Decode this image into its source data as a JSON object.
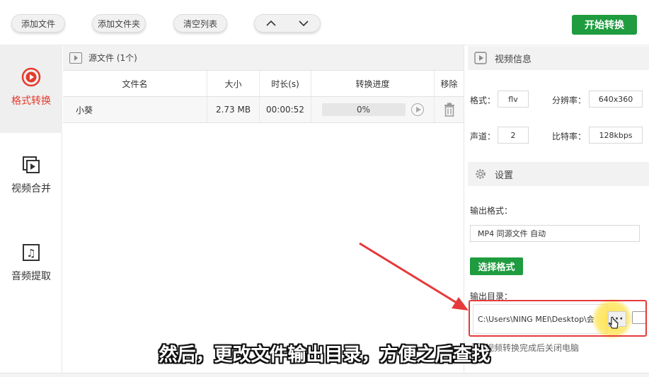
{
  "toolbar": {
    "add_file": "添加文件",
    "add_folder": "添加文件夹",
    "clear_list": "清空列表",
    "move_up": "∧",
    "move_down": "∨",
    "start": "开始转换"
  },
  "sidebar": {
    "items": [
      {
        "label": "格式转换",
        "icon": "format-convert-icon",
        "active": true
      },
      {
        "label": "视频合并",
        "icon": "video-merge-icon",
        "active": false
      },
      {
        "label": "音频提取",
        "icon": "audio-extract-icon",
        "active": false
      }
    ]
  },
  "files": {
    "header": "源文件 (1个)",
    "columns": [
      "文件名",
      "大小",
      "时长(s)",
      "转换进度",
      "移除"
    ],
    "rows": [
      {
        "name": "小葵",
        "size": "2.73 MB",
        "duration": "00:00:52",
        "progress": "0%"
      }
    ]
  },
  "video_info": {
    "title": "视频信息",
    "format_label": "格式：",
    "format_value": "flv",
    "resolution_label": "分辨率：",
    "resolution_value": "640x360",
    "channels_label": "声道：",
    "channels_value": "2",
    "bitrate_label": "比特率：",
    "bitrate_value": "128kbps"
  },
  "settings": {
    "title": "设置",
    "output_format_label": "输出格式：",
    "output_format_value": "MP4 同源文件 自动",
    "choose_format": "选择格式",
    "output_dir_label": "输出目录：",
    "output_dir_value": "C:\\Users\\NING MEI\\Desktop\\会",
    "browse": "···",
    "shutdown_label": "视频转换完成后关闭电脑"
  },
  "subtitle": "然后，更改文件输出目录，方便之后查找",
  "colors": {
    "accent_green": "#1e9c3f",
    "accent_red": "#e53a2c",
    "highlight": "#e53a3a"
  }
}
